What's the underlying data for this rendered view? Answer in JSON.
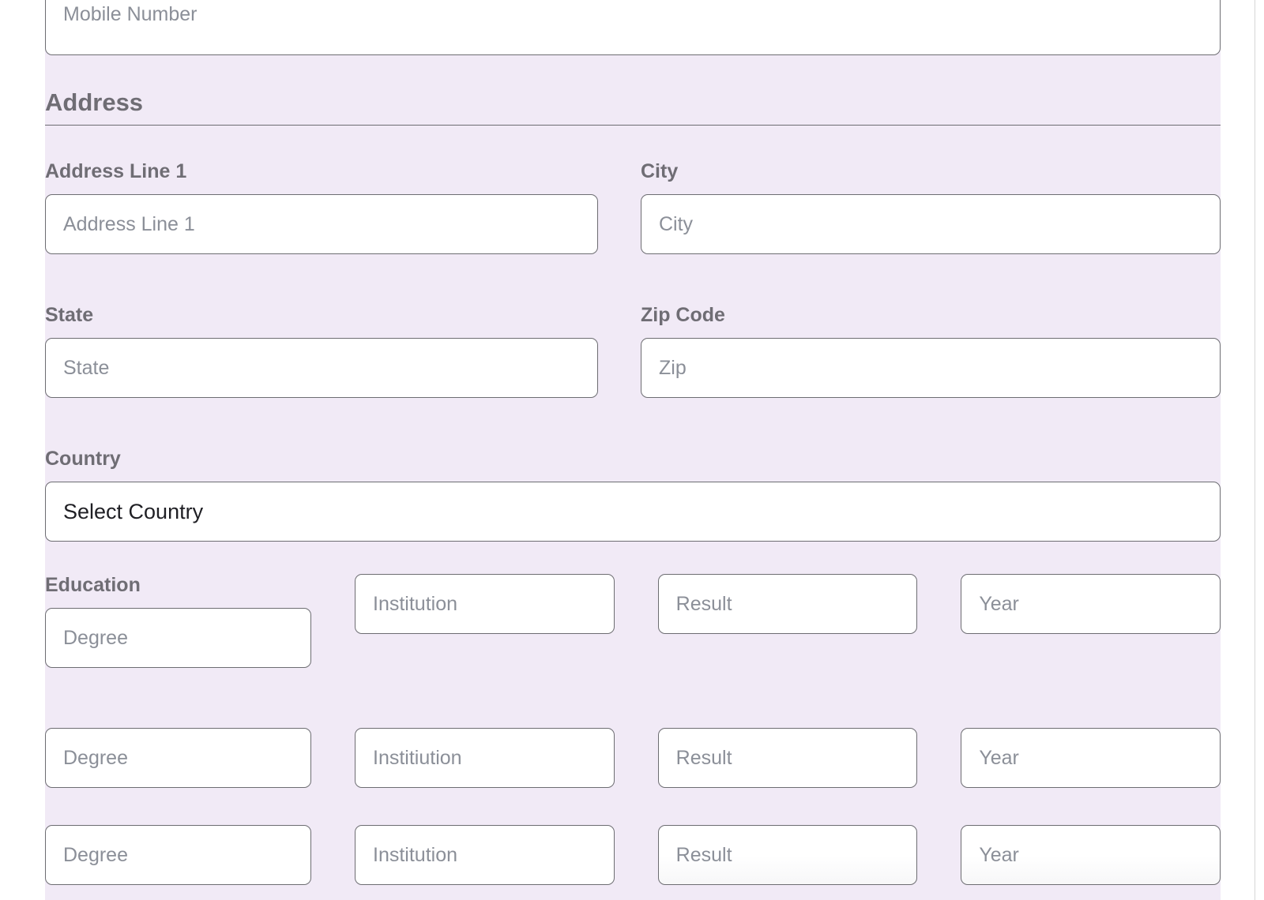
{
  "theme": {
    "card_background": "#f1eaf6",
    "page_background": "#ffffff",
    "border_color": "#6d6d72",
    "label_color": "#6f6d74",
    "placeholder_color": "#8b8f98",
    "input_background": "#ffffff"
  },
  "top_field": {
    "name": "mobile-number",
    "placeholder": "Mobile Number",
    "value": ""
  },
  "address_section": {
    "heading": "Address",
    "fields": [
      {
        "name": "address-line-1",
        "label": "Address Line 1",
        "placeholder": "Address Line 1",
        "value": ""
      },
      {
        "name": "city",
        "label": "City",
        "placeholder": "City",
        "value": ""
      },
      {
        "name": "state",
        "label": "State",
        "placeholder": "State",
        "value": ""
      },
      {
        "name": "zip-code",
        "label": "Zip Code",
        "placeholder": "Zip",
        "value": ""
      }
    ],
    "country": {
      "name": "country",
      "label": "Country",
      "selected": "Select Country",
      "options": [
        "Select Country"
      ]
    }
  },
  "education_section": {
    "label": "Education",
    "rows": [
      {
        "degree_placeholder": "Degree",
        "institution_placeholder": "Institution",
        "result_placeholder": "Result",
        "year_placeholder": "Year"
      },
      {
        "degree_placeholder": "Degree",
        "institution_placeholder": "Institiution",
        "result_placeholder": "Result",
        "year_placeholder": "Year"
      },
      {
        "degree_placeholder": "Degree",
        "institution_placeholder": "Institution",
        "result_placeholder": "Result",
        "year_placeholder": "Year"
      }
    ]
  }
}
